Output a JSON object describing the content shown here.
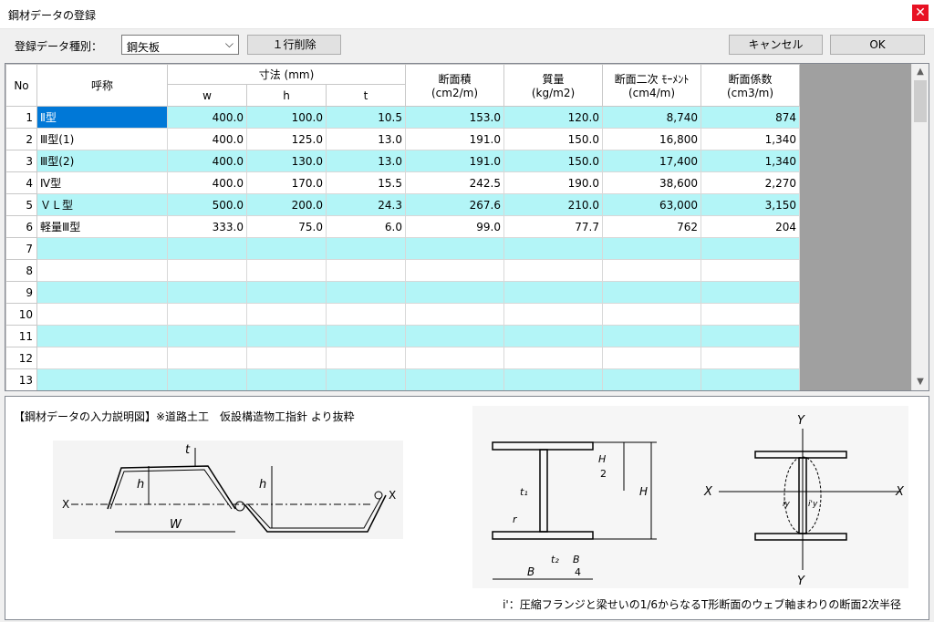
{
  "window": {
    "title": "鋼材データの登録",
    "close": "✕"
  },
  "toolbar": {
    "kind_label": "登録データ種別：",
    "kind_value": "鋼矢板",
    "delete_row": "１行削除",
    "cancel": "キャンセル",
    "ok": "OK"
  },
  "grid": {
    "headers": {
      "no": "No",
      "name": "呼称",
      "dims": "寸法 (mm)",
      "w": "w",
      "h": "h",
      "t": "t",
      "area": [
        "断面積",
        "(cm2/m)"
      ],
      "mass": [
        "質量",
        "(kg/m2)"
      ],
      "moment": [
        "断面二次 ﾓｰﾒﾝﾄ",
        "(cm4/m)"
      ],
      "modulus": [
        "断面係数",
        "(cm3/m)"
      ]
    },
    "rows": [
      {
        "no": "1",
        "name": "Ⅱ型",
        "w": "400.0",
        "h": "100.0",
        "t": "10.5",
        "area": "153.0",
        "mass": "120.0",
        "moment": "8,740",
        "modulus": "874"
      },
      {
        "no": "2",
        "name": "Ⅲ型(1)",
        "w": "400.0",
        "h": "125.0",
        "t": "13.0",
        "area": "191.0",
        "mass": "150.0",
        "moment": "16,800",
        "modulus": "1,340"
      },
      {
        "no": "3",
        "name": "Ⅲ型(2)",
        "w": "400.0",
        "h": "130.0",
        "t": "13.0",
        "area": "191.0",
        "mass": "150.0",
        "moment": "17,400",
        "modulus": "1,340"
      },
      {
        "no": "4",
        "name": "Ⅳ型",
        "w": "400.0",
        "h": "170.0",
        "t": "15.5",
        "area": "242.5",
        "mass": "190.0",
        "moment": "38,600",
        "modulus": "2,270"
      },
      {
        "no": "5",
        "name": "ＶＬ型",
        "w": "500.0",
        "h": "200.0",
        "t": "24.3",
        "area": "267.6",
        "mass": "210.0",
        "moment": "63,000",
        "modulus": "3,150"
      },
      {
        "no": "6",
        "name": "軽量Ⅲ型",
        "w": "333.0",
        "h": "75.0",
        "t": "6.0",
        "area": "99.0",
        "mass": "77.7",
        "moment": "762",
        "modulus": "204"
      },
      {
        "no": "7"
      },
      {
        "no": "8"
      },
      {
        "no": "9"
      },
      {
        "no": "10"
      },
      {
        "no": "11"
      },
      {
        "no": "12"
      },
      {
        "no": "13"
      }
    ]
  },
  "info": {
    "heading": "【鋼材データの入力説明図】※道路土工　仮設構造物工指針 より抜粋",
    "note": "i'：圧縮フランジと梁せいの1/6からなるT形断面のウェブ軸まわりの断面2次半径",
    "fig1": {
      "x": "X",
      "W": "W",
      "h": "h",
      "t": "t"
    },
    "fig2": {
      "x": "X",
      "y": "Y",
      "H": "H",
      "H2": "H",
      "two": "2",
      "B": "B",
      "B4": "B",
      "four": "4",
      "t1": "t₁",
      "t2": "t₂",
      "r": "r",
      "iy": "iy",
      "iy2": "i'y"
    }
  },
  "colors": {
    "alt_row": "#b3f5f7",
    "selected": "#0078d7",
    "close": "#e81123"
  }
}
